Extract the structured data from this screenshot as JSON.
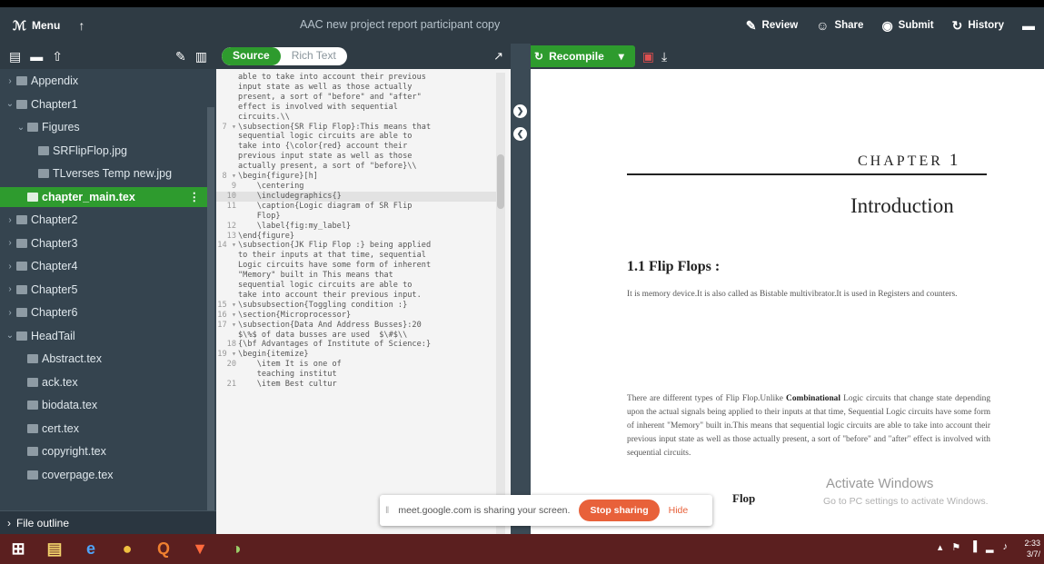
{
  "topbar": {
    "menu_label": "Menu",
    "title": "AAC new project report participant copy",
    "review": "Review",
    "share": "Share",
    "submit": "Submit",
    "history": "History"
  },
  "tree": {
    "items": [
      {
        "label": "Appendix",
        "arrow": "›",
        "indent": 0
      },
      {
        "label": "Chapter1",
        "arrow": "⌄",
        "indent": 0
      },
      {
        "label": "Figures",
        "arrow": "⌄",
        "indent": 1
      },
      {
        "label": "SRFlipFlop.jpg",
        "arrow": "",
        "indent": 2
      },
      {
        "label": "TLverses Temp new.jpg",
        "arrow": "",
        "indent": 2
      },
      {
        "label": "chapter_main.tex",
        "arrow": "",
        "indent": 1,
        "active": true
      },
      {
        "label": "Chapter2",
        "arrow": "›",
        "indent": 0
      },
      {
        "label": "Chapter3",
        "arrow": "›",
        "indent": 0
      },
      {
        "label": "Chapter4",
        "arrow": "›",
        "indent": 0
      },
      {
        "label": "Chapter5",
        "arrow": "›",
        "indent": 0
      },
      {
        "label": "Chapter6",
        "arrow": "›",
        "indent": 0
      },
      {
        "label": "HeadTail",
        "arrow": "⌄",
        "indent": 0
      },
      {
        "label": "Abstract.tex",
        "arrow": "",
        "indent": 1
      },
      {
        "label": "ack.tex",
        "arrow": "",
        "indent": 1
      },
      {
        "label": "biodata.tex",
        "arrow": "",
        "indent": 1
      },
      {
        "label": "cert.tex",
        "arrow": "",
        "indent": 1
      },
      {
        "label": "copyright.tex",
        "arrow": "",
        "indent": 1
      },
      {
        "label": "coverpage.tex",
        "arrow": "",
        "indent": 1
      }
    ],
    "file_outline": "File outline"
  },
  "editor": {
    "source_label": "Source",
    "rich_text_label": "Rich Text",
    "lines": [
      {
        "n": "",
        "t": "able to take into account their previous"
      },
      {
        "n": "",
        "t": "input state as well as those actually"
      },
      {
        "n": "",
        "t": "present, a sort of \"before\" and \"after\""
      },
      {
        "n": "",
        "t": "effect is involved with sequential"
      },
      {
        "n": "",
        "t": "circuits.\\\\"
      },
      {
        "n": "7 ▾",
        "t": "\\subsection{SR Flip Flop}:This means that"
      },
      {
        "n": "",
        "t": "sequential logic circuits are able to"
      },
      {
        "n": "",
        "t": "take into {\\color{red} account their"
      },
      {
        "n": "",
        "t": "previous input state as well as those"
      },
      {
        "n": "",
        "t": "actually present, a sort of \"before}\\\\"
      },
      {
        "n": "8 ▾",
        "t": "\\begin{figure}[h]"
      },
      {
        "n": "9",
        "t": "    \\centering"
      },
      {
        "n": "10",
        "t": "    \\includegraphics{}",
        "hl": true
      },
      {
        "n": "11",
        "t": "    \\caption{Logic diagram of SR Flip"
      },
      {
        "n": "",
        "t": "    Flop}"
      },
      {
        "n": "12",
        "t": "    \\label{fig:my_label}"
      },
      {
        "n": "13",
        "t": "\\end{figure}"
      },
      {
        "n": "14 ▾",
        "t": "\\subsection{JK Flip Flop :} being applied"
      },
      {
        "n": "",
        "t": "to their inputs at that time, sequential"
      },
      {
        "n": "",
        "t": "Logic circuits have some form of inherent"
      },
      {
        "n": "",
        "t": "\"Memory\" built in This means that"
      },
      {
        "n": "",
        "t": "sequential logic circuits are able to"
      },
      {
        "n": "",
        "t": "take into account their previous input."
      },
      {
        "n": "15 ▾",
        "t": "\\subsubsection{Toggling condition :}"
      },
      {
        "n": "16 ▾",
        "t": "\\section{Microprocessor}"
      },
      {
        "n": "17 ▾",
        "t": "\\subsection{Data And Address Busses}:20"
      },
      {
        "n": "",
        "t": "$\\%$ of data busses are used  $\\#$\\\\"
      },
      {
        "n": "18",
        "t": "{\\bf Advantages of Institute of Science:}"
      },
      {
        "n": "19 ▾",
        "t": "\\begin{itemize}"
      },
      {
        "n": "20",
        "t": "    \\item It is one of"
      },
      {
        "n": "",
        "t": "    teaching institut"
      },
      {
        "n": "21",
        "t": "    \\item Best cultur"
      }
    ]
  },
  "preview": {
    "recompile_label": "Recompile",
    "chapter_word": "CHAPTER",
    "chapter_num": "1",
    "heading": "Introduction",
    "section": "1.1   Flip Flops :",
    "para1": "It is memory device.It is also called as Bistable multivibrator.It is used in Registers and counters.",
    "para2_pre": "There are different types of Flip Flop.Unlike ",
    "para2_bold": "Combinational",
    "para2_post": " Logic circuits that change state depending upon the actual signals being applied to their inputs at that time, Sequential Logic circuits have some form of inherent \"Memory\" built in.This means that sequential logic circuits are able to take into account their previous input state as well as those actually present, a sort of \"before\" and \"after\" effect is involved with sequential circuits.",
    "subheading": "Flop",
    "watermark_title": "Activate Windows",
    "watermark_sub": "Go to PC settings to activate Windows."
  },
  "share_bar": {
    "message": "meet.google.com is sharing your screen.",
    "stop_label": "Stop sharing",
    "hide_label": "Hide"
  },
  "taskbar": {
    "clock_time": "2:33",
    "clock_date": "3/7/"
  }
}
